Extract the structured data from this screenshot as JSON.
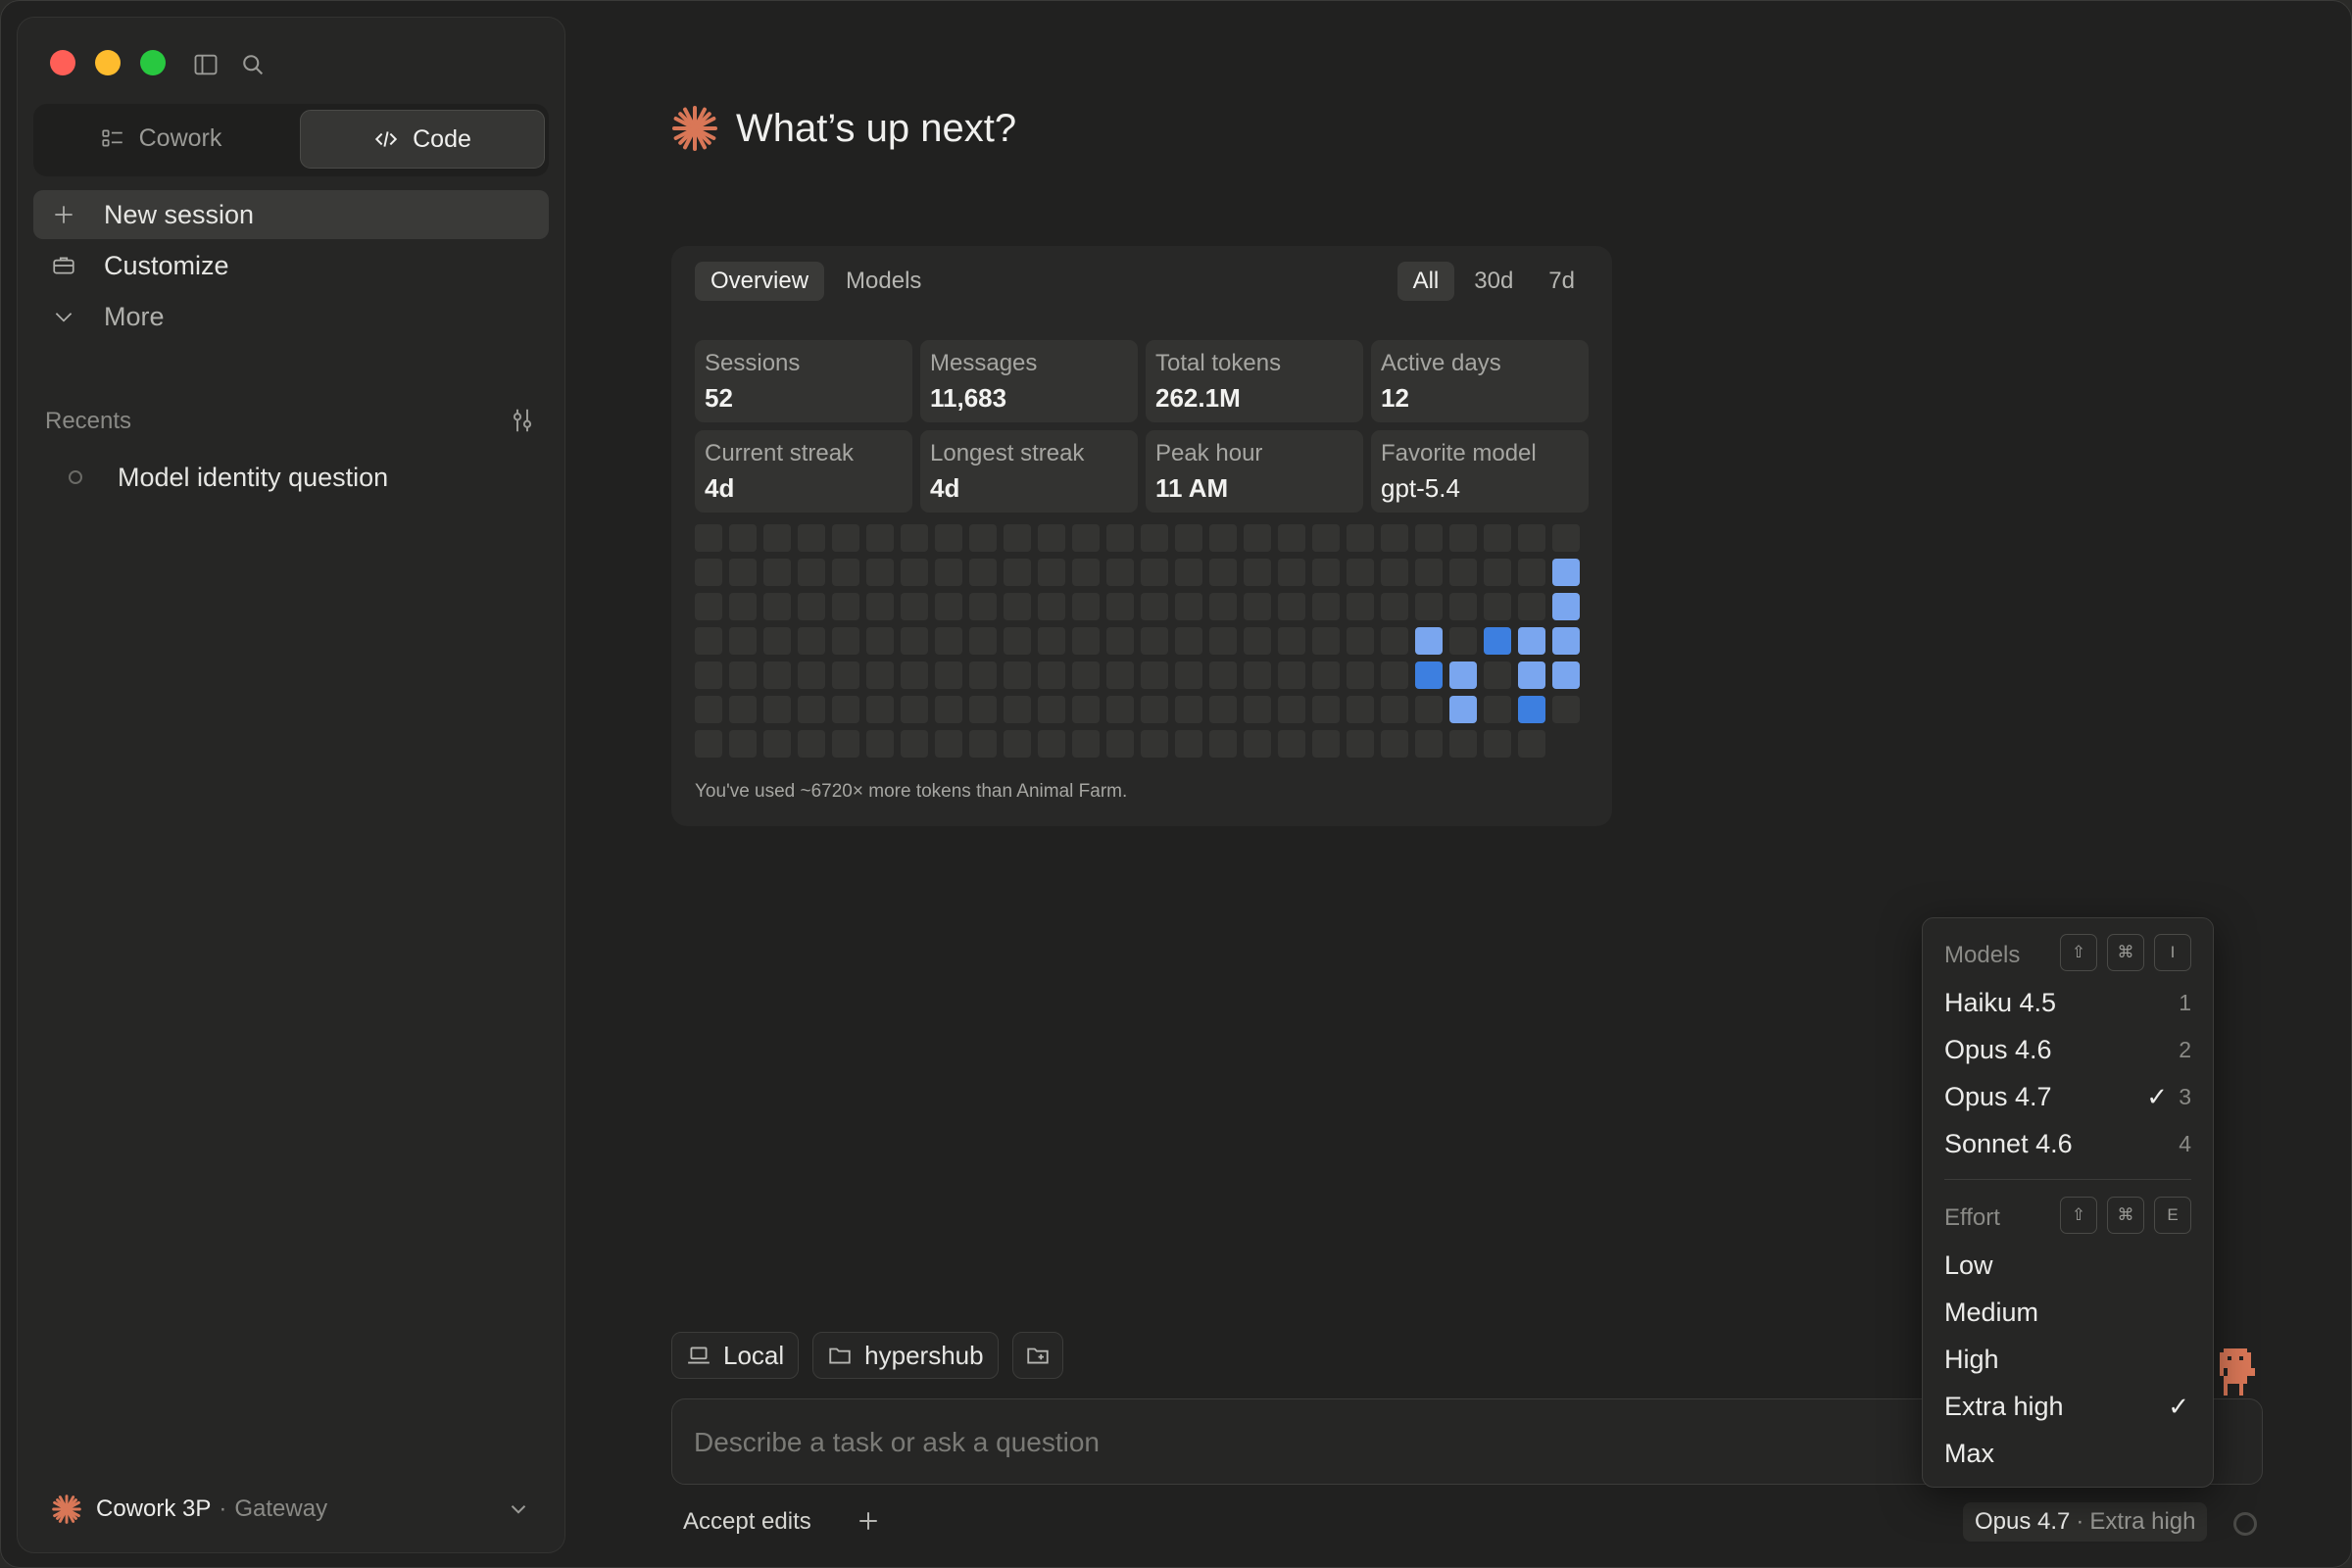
{
  "sidebar": {
    "mode_tabs": [
      {
        "label": "Cowork",
        "active": false
      },
      {
        "label": "Code",
        "active": true
      }
    ],
    "nav": {
      "new_session": "New session",
      "customize": "Customize",
      "more": "More"
    },
    "recents_label": "Recents",
    "recents": [
      {
        "label": "Model identity question"
      }
    ],
    "account": {
      "name": "Cowork 3P",
      "separator": "·",
      "gateway": "Gateway"
    }
  },
  "main": {
    "headline": "What’s up next?",
    "stats": {
      "tabs": [
        "Overview",
        "Models"
      ],
      "active_tab": "Overview",
      "ranges": [
        "All",
        "30d",
        "7d"
      ],
      "active_range": "All",
      "cards": [
        {
          "label": "Sessions",
          "value": "52"
        },
        {
          "label": "Messages",
          "value": "11,683"
        },
        {
          "label": "Total tokens",
          "value": "262.1M"
        },
        {
          "label": "Active days",
          "value": "12"
        },
        {
          "label": "Current streak",
          "value": "4d"
        },
        {
          "label": "Longest streak",
          "value": "4d"
        },
        {
          "label": "Peak hour",
          "value": "11 AM"
        },
        {
          "label": "Favorite model",
          "value": "gpt-5.4"
        }
      ],
      "footnote": "You've used ~6720× more tokens than Animal Farm.",
      "heatmap": {
        "rows": 7,
        "cols": 26,
        "active_cells": [
          {
            "row": 1,
            "col": 25,
            "level": 2
          },
          {
            "row": 2,
            "col": 25,
            "level": 2
          },
          {
            "row": 3,
            "col": 21,
            "level": 2
          },
          {
            "row": 3,
            "col": 23,
            "level": 3
          },
          {
            "row": 3,
            "col": 24,
            "level": 2
          },
          {
            "row": 3,
            "col": 25,
            "level": 2
          },
          {
            "row": 4,
            "col": 21,
            "level": 3
          },
          {
            "row": 4,
            "col": 22,
            "level": 2
          },
          {
            "row": 4,
            "col": 24,
            "level": 2
          },
          {
            "row": 4,
            "col": 25,
            "level": 2
          },
          {
            "row": 5,
            "col": 22,
            "level": 2
          },
          {
            "row": 5,
            "col": 24,
            "level": 3
          }
        ],
        "colors": {
          "empty": "#343432",
          "level2": "#7aa6ef",
          "level3": "#3d7fe0"
        }
      }
    },
    "chips": {
      "local": "Local",
      "folder": "hypershub"
    },
    "input_placeholder": "Describe a task or ask a question",
    "accept_edits": "Accept edits",
    "model_pill": {
      "model": "Opus 4.7",
      "separator": "·",
      "effort": "Extra high"
    }
  },
  "menu": {
    "models_header": "Models",
    "models_shortcut": [
      "⇧",
      "⌘",
      "I"
    ],
    "models": [
      {
        "label": "Haiku 4.5",
        "key": "1",
        "selected": false
      },
      {
        "label": "Opus 4.6",
        "key": "2",
        "selected": false
      },
      {
        "label": "Opus 4.7",
        "key": "3",
        "selected": true
      },
      {
        "label": "Sonnet 4.6",
        "key": "4",
        "selected": false
      }
    ],
    "effort_header": "Effort",
    "effort_shortcut": [
      "⇧",
      "⌘",
      "E"
    ],
    "efforts": [
      {
        "label": "Low",
        "selected": false
      },
      {
        "label": "Medium",
        "selected": false
      },
      {
        "label": "High",
        "selected": false
      },
      {
        "label": "Extra high",
        "selected": true
      },
      {
        "label": "Max",
        "selected": false
      }
    ],
    "check_glyph": "✓"
  },
  "colors": {
    "accent": "#d97757",
    "traffic_red": "#ff5f57",
    "traffic_yellow": "#febc2e",
    "traffic_green": "#28c840"
  }
}
